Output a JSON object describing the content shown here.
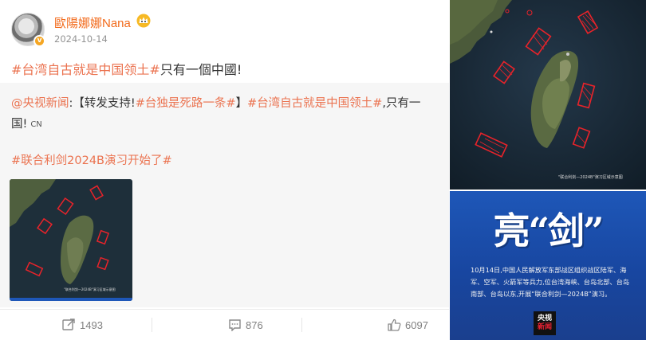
{
  "post": {
    "username": "歐陽娜娜Nana",
    "date": "2024-10-14",
    "tag1": "#台湾自古就是中国领土#",
    "text1": "只有一個中國!",
    "repost": {
      "author": "@央视新闻",
      "colon": ":",
      "line1_a": "【转发支持!",
      "line1_tag1": "#台独是死路一条#",
      "line1_b": "】",
      "line1_tag2": "#台湾自古就是中国领土#",
      "line1_c": ",只有一",
      "line2": "国!",
      "cn_mark": "CN",
      "tag3": "#联合利剑2024B演习开始了#"
    },
    "map_caption": "\"联合利剑—2024B\"演习区域示意图"
  },
  "actions": {
    "share_count": "1493",
    "comment_count": "876",
    "like_count": "6097"
  },
  "news_card": {
    "title": "亮“剑”",
    "body": "10月14日,中国人民解放军东部战区组织战区陆军、海军、空军、火箭军等兵力,位台湾海峡、台岛北部、台岛南部、台岛以东,开展“联合利剑—2024B”演习。",
    "logo_top": "央视",
    "logo_bottom": "新闻"
  },
  "colors": {
    "accent": "#eb7350",
    "username": "#f26a1b",
    "blue_card": "#1e57b8",
    "zone_red": "#e8232a"
  },
  "icons": [
    "share-icon",
    "comment-icon",
    "like-icon",
    "verified-badge-icon",
    "crown-badge-icon"
  ]
}
